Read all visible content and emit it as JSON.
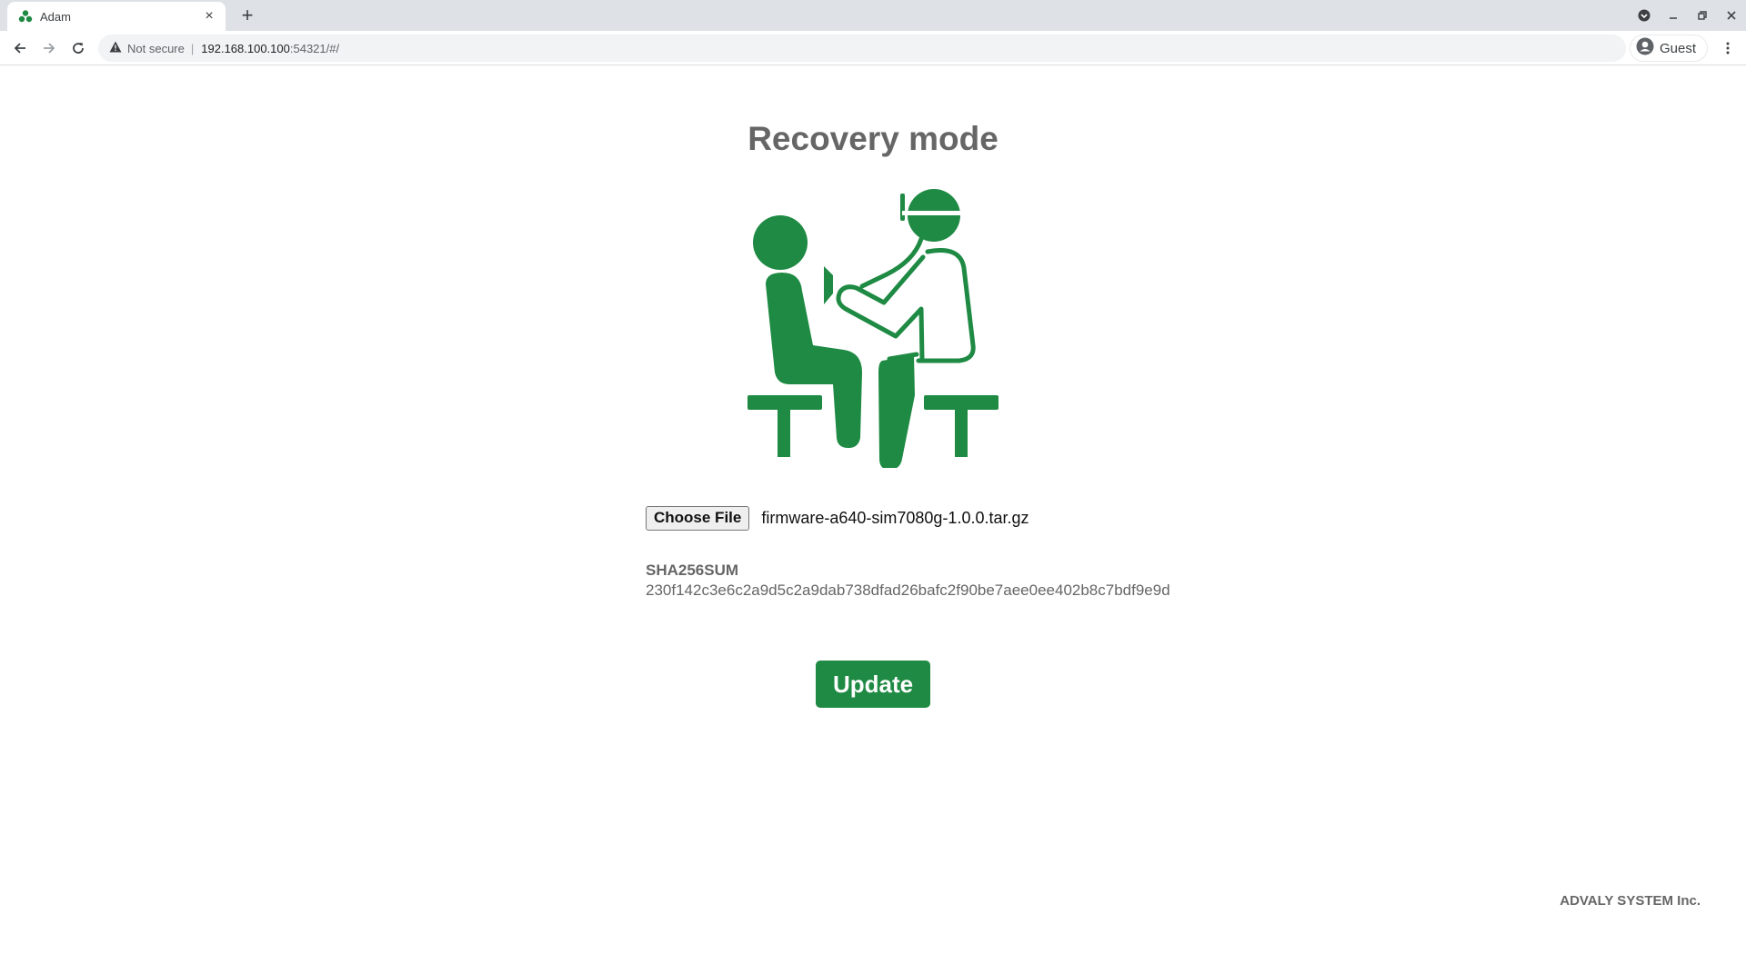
{
  "browser": {
    "tab_title": "Adam",
    "tab_close": "×",
    "new_tab": "+",
    "security_label": "Not secure",
    "separator": "|",
    "url_host": "192.168.100.100",
    "url_rest": ":54321/#/",
    "profile_name": "Guest"
  },
  "page": {
    "title": "Recovery mode",
    "illustration": "doctor-examining-patient-illustration",
    "choose_file_label": "Choose File",
    "selected_file": "firmware-a640-sim7080g-1.0.0.tar.gz",
    "sha_label": "SHA256SUM",
    "sha_value": "230f142c3e6c2a9d5c2a9dab738dfad26bafc2f90be7aee0ee402b8c7bdf9e9d",
    "update_label": "Update",
    "footer": "ADVALY SYSTEM Inc."
  },
  "colors": {
    "accent": "#1e8a43",
    "text_muted": "#666666"
  }
}
